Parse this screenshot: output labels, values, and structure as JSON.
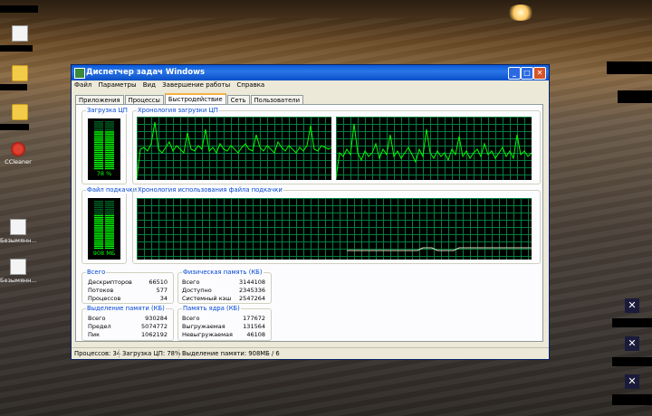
{
  "desktop": {
    "icons": [
      {
        "label": ""
      },
      {
        "label": ""
      },
      {
        "label": ""
      },
      {
        "label": "CCleaner"
      },
      {
        "label": "Безымянн..."
      },
      {
        "label": "Безымянн..."
      }
    ]
  },
  "window": {
    "title": "Диспетчер задач Windows",
    "minimize_glyph": "_",
    "maximize_glyph": "□",
    "close_glyph": "✕",
    "menu": [
      "Файл",
      "Параметры",
      "Вид",
      "Завершение работы",
      "Справка"
    ],
    "tabs": [
      {
        "label": "Приложения",
        "active": false
      },
      {
        "label": "Процессы",
        "active": false
      },
      {
        "label": "Быстродействие",
        "active": true
      },
      {
        "label": "Сеть",
        "active": false
      },
      {
        "label": "Пользователи",
        "active": false
      }
    ]
  },
  "performance": {
    "cpu_usage": {
      "title": "Загрузка ЦП",
      "value_label": "78 %",
      "percent": 78
    },
    "cpu_history": {
      "title": "Хронология загрузки ЦП"
    },
    "pagefile": {
      "title": "Файл подкачки",
      "value_label": "908 МБ",
      "percent": 70
    },
    "pagefile_history": {
      "title": "Хронология использования файла подкачки"
    },
    "totals": {
      "title": "Всего",
      "rows": [
        {
          "label": "Дескрипторов",
          "value": "66510"
        },
        {
          "label": "Потоков",
          "value": "577"
        },
        {
          "label": "Процессов",
          "value": "34"
        }
      ]
    },
    "physical_memory": {
      "title": "Физическая память (КБ)",
      "rows": [
        {
          "label": "Всего",
          "value": "3144108"
        },
        {
          "label": "Доступно",
          "value": "2345336"
        },
        {
          "label": "Системный кэш",
          "value": "2547264"
        }
      ]
    },
    "commit_charge": {
      "title": "Выделение памяти (КБ)",
      "rows": [
        {
          "label": "Всего",
          "value": "930284"
        },
        {
          "label": "Предел",
          "value": "5074772"
        },
        {
          "label": "Пик",
          "value": "1062192"
        }
      ]
    },
    "kernel_memory": {
      "title": "Память ядра (КБ)",
      "rows": [
        {
          "label": "Всего",
          "value": "177672"
        },
        {
          "label": "Выгружаемая",
          "value": "131564"
        },
        {
          "label": "Невыгружаемая",
          "value": "46108"
        }
      ]
    }
  },
  "statusbar": {
    "processes": "Процессов: 34",
    "cpu": "Загрузка ЦП: 78%",
    "commit": "Выделение памяти: 908МБ / 6"
  },
  "colors": {
    "graph_line": "#00ff00",
    "grid": "#008040",
    "title_bar": "#0a5ad8"
  }
}
